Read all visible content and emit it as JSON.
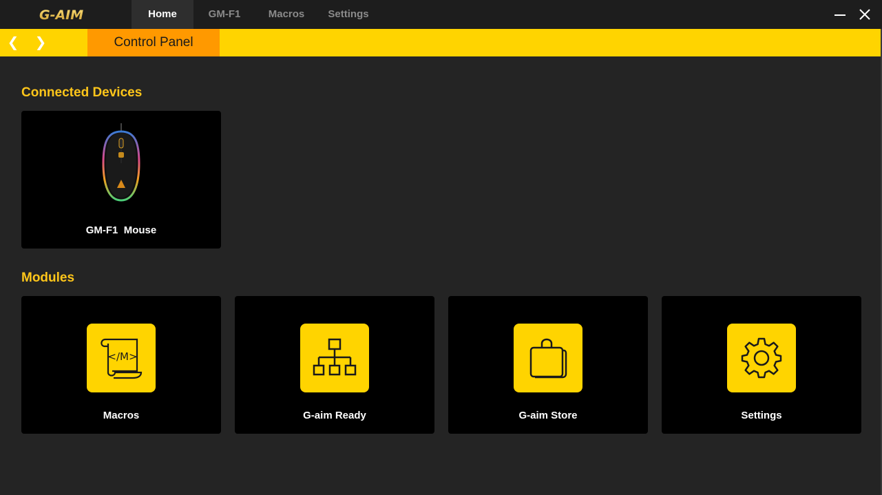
{
  "app": {
    "logo_text": "G-AIM"
  },
  "nav": {
    "tabs": [
      {
        "label": "Home",
        "active": true
      },
      {
        "label": "GM-F1",
        "active": false
      },
      {
        "label": "Macros",
        "active": false
      },
      {
        "label": "Settings",
        "active": false
      }
    ]
  },
  "window_controls": {
    "minimize_icon": "minimize-icon",
    "close_icon": "close-icon"
  },
  "subbar": {
    "back_glyph": "❮",
    "forward_glyph": "❯",
    "panel_label": "Control Panel"
  },
  "connected_devices": {
    "title": "Connected Devices",
    "devices": [
      {
        "label": "GM-F1  Mouse",
        "icon": "mouse-image"
      }
    ]
  },
  "modules": {
    "title": "Modules",
    "items": [
      {
        "label": "Macros",
        "icon": "macro-scroll-icon",
        "icon_text": "</M>"
      },
      {
        "label": "G-aim Ready",
        "icon": "network-hierarchy-icon"
      },
      {
        "label": "G-aim Store",
        "icon": "shopping-bag-icon"
      },
      {
        "label": "Settings",
        "icon": "gear-icon"
      }
    ]
  },
  "colors": {
    "accent_yellow": "#ffd400",
    "active_orange": "#ff9900",
    "heading_yellow": "#ffc61a",
    "background": "#242424"
  }
}
